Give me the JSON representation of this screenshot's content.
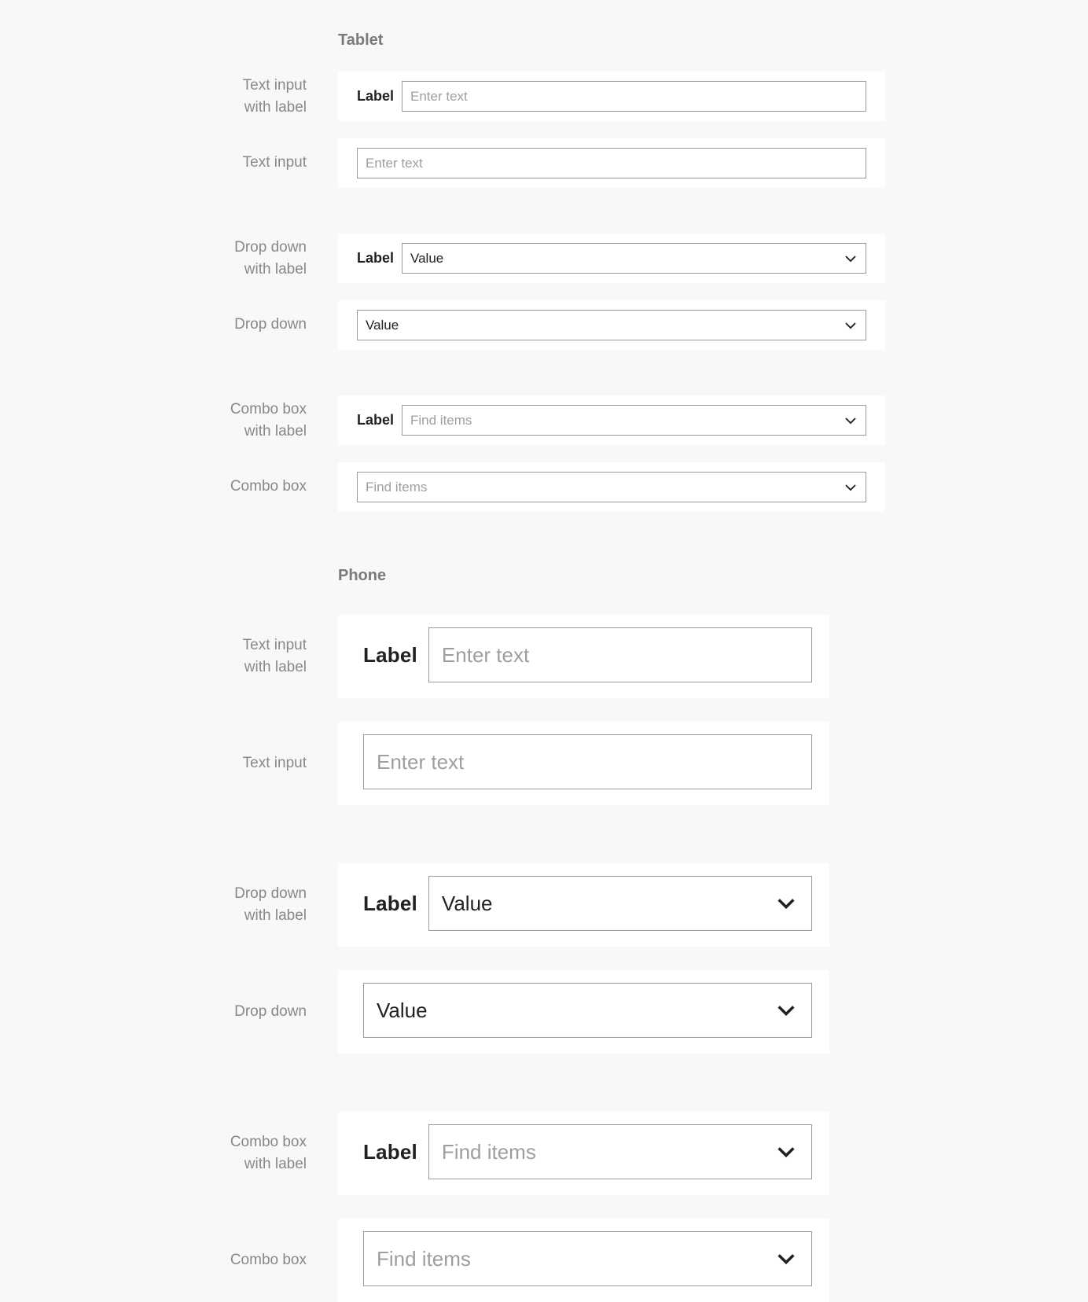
{
  "section_tablet": "Tablet",
  "section_phone": "Phone",
  "captions": {
    "text_input_with_label_l1": "Text input",
    "text_input_with_label_l2": "with label",
    "text_input": "Text input",
    "dropdown_with_label_l1": "Drop down",
    "dropdown_with_label_l2": "with label",
    "dropdown": "Drop down",
    "combobox_with_label_l1": "Combo box",
    "combobox_with_label_l2": "with label",
    "combobox": "Combo box"
  },
  "tablet": {
    "text_input_with_label": {
      "label": "Label",
      "placeholder": "Enter text"
    },
    "text_input": {
      "placeholder": "Enter text"
    },
    "dropdown_with_label": {
      "label": "Label",
      "value": "Value"
    },
    "dropdown": {
      "value": "Value"
    },
    "combobox_with_label": {
      "label": "Label",
      "placeholder": "Find items"
    },
    "combobox": {
      "placeholder": "Find items"
    }
  },
  "phone": {
    "text_input_with_label": {
      "label": "Label",
      "placeholder": "Enter text"
    },
    "text_input": {
      "placeholder": "Enter text"
    },
    "dropdown_with_label": {
      "label": "Label",
      "value": "Value"
    },
    "dropdown": {
      "value": "Value"
    },
    "combobox_with_label": {
      "label": "Label",
      "placeholder": "Find items"
    },
    "combobox": {
      "placeholder": "Find items"
    }
  }
}
